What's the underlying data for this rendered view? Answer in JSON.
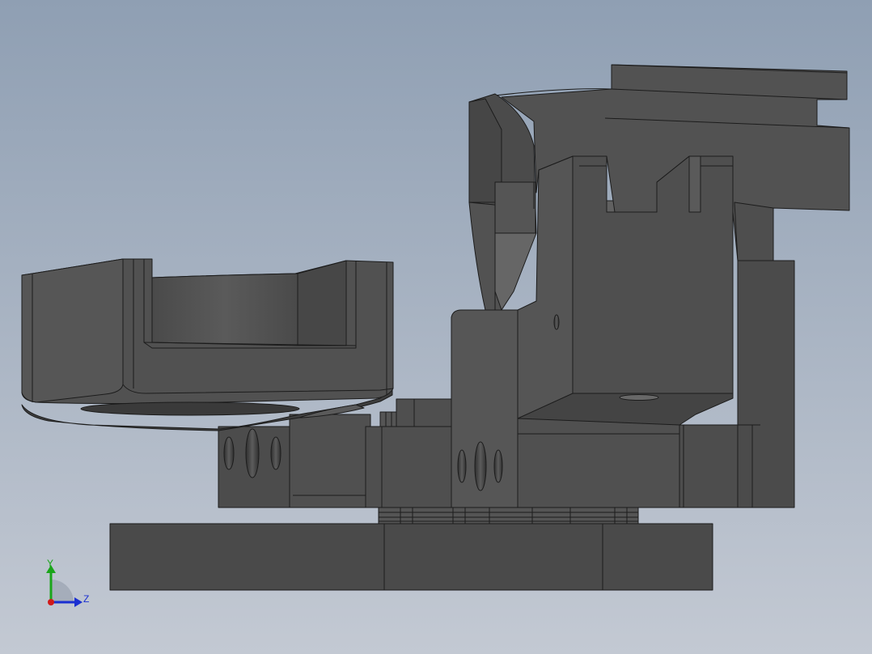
{
  "viewport": {
    "background_top": "#8f9fb3",
    "background_bottom": "#c3c9d3",
    "model": {
      "face_dark": "#454545",
      "face_mid": "#525252",
      "face_light": "#5e5e5e",
      "face_highlight": "#6a6a6a",
      "edge": "#1c1c1c"
    }
  },
  "triad": {
    "y_label": "Y",
    "z_label": "Z",
    "y_color": "#1aa51a",
    "z_color": "#1a2fd1",
    "x_color": "#d11a1a"
  }
}
